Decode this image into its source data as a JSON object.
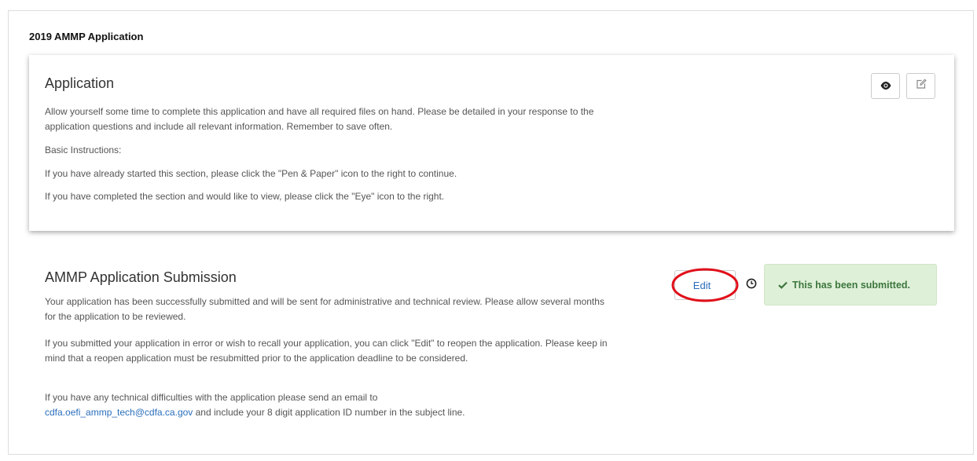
{
  "page": {
    "title": "2019 AMMP Application"
  },
  "application_card": {
    "heading": "Application",
    "intro": "Allow yourself some time to complete this application and have all required files on hand. Please be detailed in your response to the application questions and include all relevant information. Remember to save often.",
    "basic_instructions": "Basic Instructions:",
    "instruction_continue": "If you have already started this section, please click the \"Pen & Paper\" icon to the right to continue.",
    "instruction_view": "If you have completed the section and would like to view, please click the \"Eye\" icon to the right.",
    "view_icon": "eye-icon",
    "edit_icon": "pencil-square-icon"
  },
  "submission": {
    "heading": "AMMP Application Submission",
    "paragraph1": "Your application has been successfully submitted and will be sent for administrative and technical review.  Please allow several months for the application to be reviewed.",
    "paragraph2": "If you submitted your application in error or wish to recall your application, you can click \"Edit\" to reopen the application. Please keep in mind that a reopen application must be resubmitted prior to the application deadline to be considered.",
    "paragraph3_before": "If you have any technical difficulties with the application please send an email to",
    "email": "cdfa.oefi_ammp_tech@cdfa.ca.gov",
    "paragraph3_after": " and include your 8 digit application ID number in the subject line.",
    "edit_button_label": "Edit",
    "status_message": "This has been submitted."
  },
  "colors": {
    "link": "#2a6ebb",
    "success_bg": "#dff0d8",
    "success_text": "#3c763d",
    "highlight": "#e0101a"
  }
}
